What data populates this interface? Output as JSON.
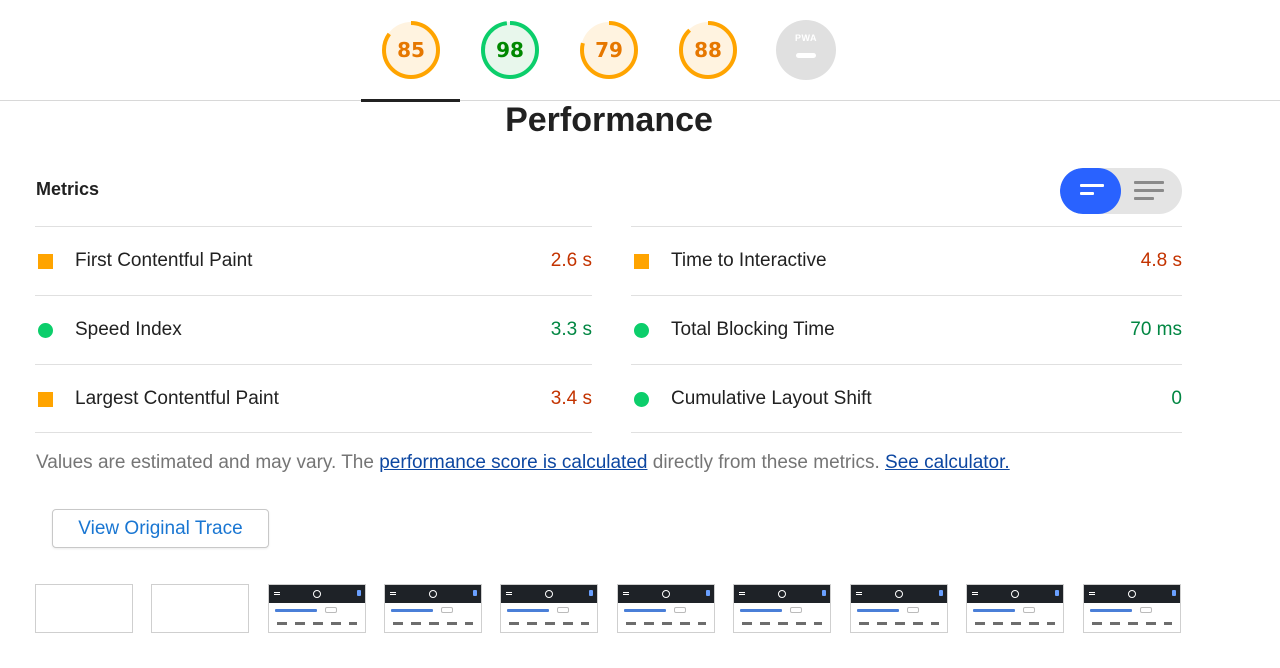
{
  "scores": [
    {
      "label": "85",
      "value": 85,
      "status": "average"
    },
    {
      "label": "98",
      "value": 98,
      "status": "pass"
    },
    {
      "label": "79",
      "value": 79,
      "status": "average"
    },
    {
      "label": "88",
      "value": 88,
      "status": "average"
    },
    {
      "label": "PWA",
      "value": null,
      "status": "na"
    }
  ],
  "section_title": "Performance",
  "metrics_header": "Metrics",
  "metrics": {
    "left": [
      {
        "label": "First Contentful Paint",
        "value": "2.6 s",
        "status": "average",
        "icon": "orange-square-icon"
      },
      {
        "label": "Speed Index",
        "value": "3.3 s",
        "status": "pass",
        "icon": "green-circle-icon"
      },
      {
        "label": "Largest Contentful Paint",
        "value": "3.4 s",
        "status": "average",
        "icon": "orange-square-icon"
      }
    ],
    "right": [
      {
        "label": "Time to Interactive",
        "value": "4.8 s",
        "status": "average",
        "icon": "orange-square-icon"
      },
      {
        "label": "Total Blocking Time",
        "value": "70 ms",
        "status": "pass",
        "icon": "green-circle-icon"
      },
      {
        "label": "Cumulative Layout Shift",
        "value": "0",
        "status": "pass",
        "icon": "green-circle-icon"
      }
    ]
  },
  "footnote": {
    "prefix": "Values are estimated and may vary. The ",
    "link1": "performance score is calculated",
    "middle": " directly from these metrics. ",
    "link2": "See calculator."
  },
  "trace_button": "View Original Trace",
  "filmstrip_frames": 10,
  "colors": {
    "average": "#ffa400",
    "pass": "#0cce6b",
    "na": "#e0e0e0",
    "accent": "#2962ff"
  }
}
